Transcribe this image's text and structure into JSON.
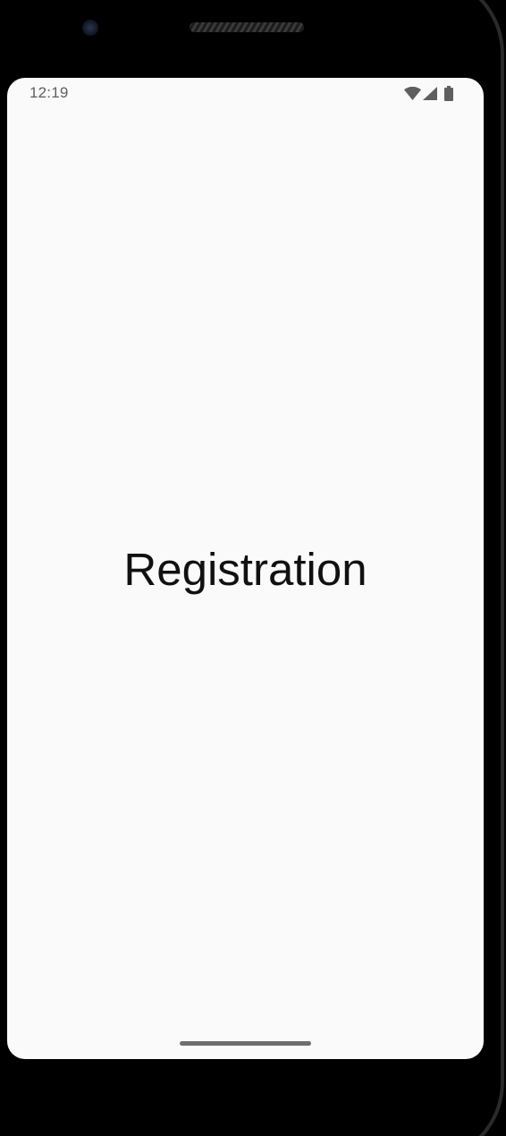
{
  "status_bar": {
    "time": "12:19",
    "icons": [
      "wifi-icon",
      "cellular-signal-icon",
      "battery-icon"
    ]
  },
  "screen": {
    "title": "Registration",
    "background": "#fafafa",
    "title_color": "#111111"
  }
}
